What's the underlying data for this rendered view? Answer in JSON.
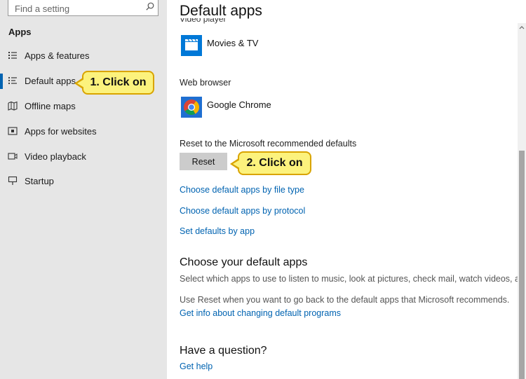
{
  "search": {
    "placeholder": "Find a setting"
  },
  "sidebar": {
    "heading": "Apps",
    "items": [
      {
        "label": "Apps & features",
        "icon": "list-icon"
      },
      {
        "label": "Default apps",
        "icon": "default-apps-icon",
        "selected": true
      },
      {
        "label": "Offline maps",
        "icon": "map-icon"
      },
      {
        "label": "Apps for websites",
        "icon": "website-icon"
      },
      {
        "label": "Video playback",
        "icon": "video-icon"
      },
      {
        "label": "Startup",
        "icon": "startup-icon"
      }
    ]
  },
  "main": {
    "title": "Default apps",
    "video_player": {
      "label": "Video player",
      "app": "Movies & TV"
    },
    "web_browser": {
      "label": "Web browser",
      "app": "Google Chrome"
    },
    "reset": {
      "label": "Reset to the Microsoft recommended defaults",
      "button": "Reset"
    },
    "links": {
      "by_file_type": "Choose default apps by file type",
      "by_protocol": "Choose default apps by protocol",
      "by_app": "Set defaults by app"
    },
    "choose_section": {
      "heading": "Choose your default apps",
      "description": "Select which apps to use to listen to music, look at pictures, check mail, watch videos, and more.",
      "reset_note": "Use Reset when you want to go back to the default apps that Microsoft recommends.",
      "info_link": "Get info about changing default programs"
    },
    "question_section": {
      "heading": "Have a question?",
      "help_link": "Get help"
    }
  },
  "callouts": {
    "first": "1. Click on",
    "second": "2. Click on"
  },
  "colors": {
    "accent": "#0063b1",
    "callout_fill": "#fcf27d",
    "callout_border": "#d9a400"
  }
}
